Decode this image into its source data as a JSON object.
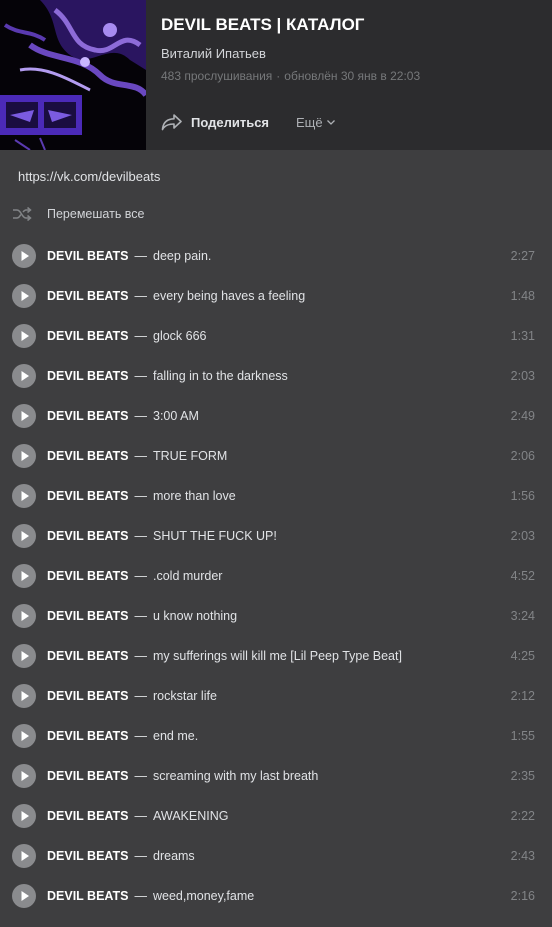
{
  "playlist": {
    "title": "DEVIL BEATS | КАТАЛОГ",
    "author": "Виталий Ипатьев",
    "plays": "483 прослушивания",
    "updated": "обновлён 30 янв в 22:03",
    "meta_separator": "·",
    "cover_icon": "playlist-cover-art"
  },
  "actions": {
    "share_label": "Поделиться",
    "share_icon": "share-arrow-icon",
    "more_label": "Ещё",
    "more_icon": "chevron-down-icon"
  },
  "description": {
    "link": "https://vk.com/devilbeats"
  },
  "shuffle": {
    "label": "Перемешать все",
    "icon": "shuffle-icon"
  },
  "separator": "—",
  "tracks": [
    {
      "artist": "DEVIL BEATS",
      "title": "deep pain.",
      "duration": "2:27"
    },
    {
      "artist": "DEVIL BEATS",
      "title": "every being haves a feeling",
      "duration": "1:48"
    },
    {
      "artist": "DEVIL BEATS",
      "title": "glock 666",
      "duration": "1:31"
    },
    {
      "artist": "DEVIL BEATS",
      "title": "falling in to the darkness",
      "duration": "2:03"
    },
    {
      "artist": "DEVIL BEATS",
      "title": "3:00 AM",
      "duration": "2:49"
    },
    {
      "artist": "DEVIL BEATS",
      "title": "TRUE FORM",
      "duration": "2:06"
    },
    {
      "artist": "DEVIL BEATS",
      "title": "more than love",
      "duration": "1:56"
    },
    {
      "artist": "DEVIL BEATS",
      "title": "SHUT THE FUCK UP!",
      "duration": "2:03"
    },
    {
      "artist": "DEVIL BEATS",
      "title": ".cold murder",
      "duration": "4:52"
    },
    {
      "artist": "DEVIL BEATS",
      "title": "u know nothing",
      "duration": "3:24"
    },
    {
      "artist": "DEVIL BEATS",
      "title": "my sufferings will kill me [Lil Peep Type Beat]",
      "duration": "4:25"
    },
    {
      "artist": "DEVIL BEATS",
      "title": "rockstar life",
      "duration": "2:12"
    },
    {
      "artist": "DEVIL BEATS",
      "title": "end me.",
      "duration": "1:55"
    },
    {
      "artist": "DEVIL BEATS",
      "title": "screaming with my last breath",
      "duration": "2:35"
    },
    {
      "artist": "DEVIL BEATS",
      "title": "AWAKENING",
      "duration": "2:22"
    },
    {
      "artist": "DEVIL BEATS",
      "title": "dreams",
      "duration": "2:43"
    },
    {
      "artist": "DEVIL BEATS",
      "title": "weed,money,fame",
      "duration": "2:16"
    }
  ],
  "colors": {
    "background": "#3e3e40",
    "header_background": "#2c2c2e",
    "cover_accent": "#4b2ab8",
    "play_button": "#8a8b8e",
    "text_primary": "#e1e3e6",
    "text_secondary": "#828487"
  }
}
